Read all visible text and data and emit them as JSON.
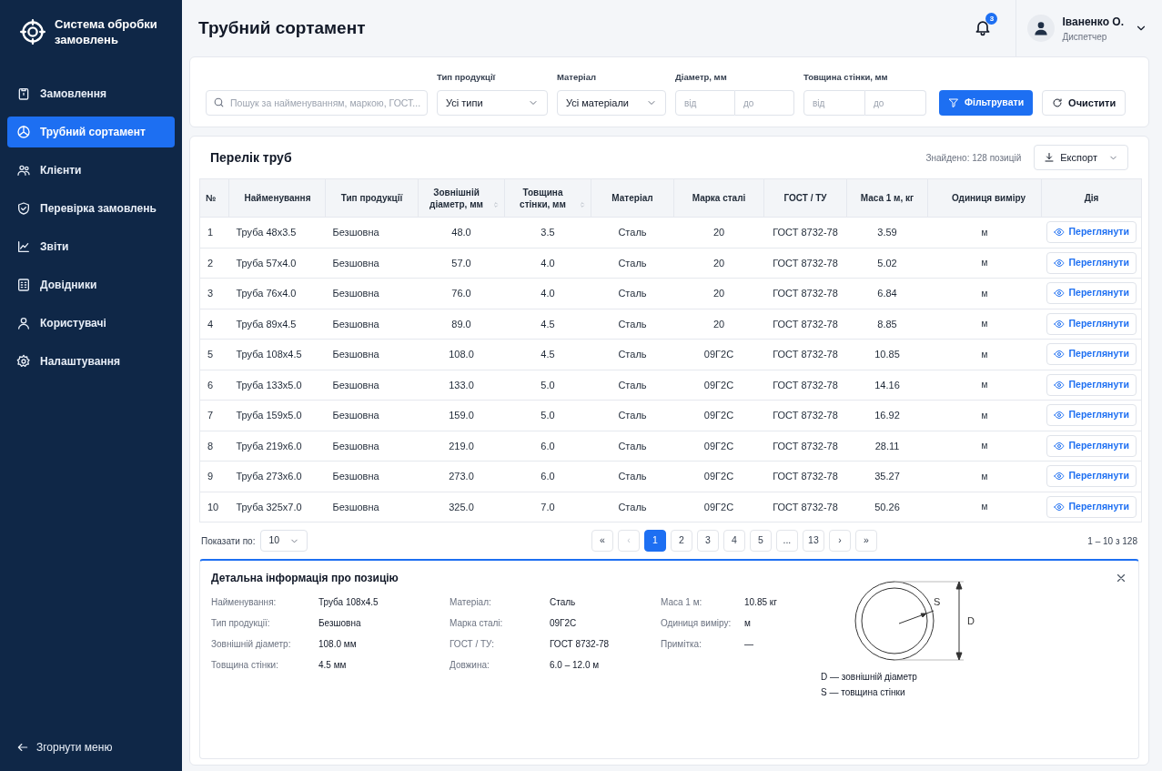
{
  "app": {
    "title": "Система обробки замовлень"
  },
  "sidebar": {
    "items": [
      {
        "label": "Замовлення",
        "selected": false
      },
      {
        "label": "Трубний сортамент",
        "selected": true
      },
      {
        "label": "Клієнти",
        "selected": false
      },
      {
        "label": "Перевірка замовлень",
        "selected": false
      },
      {
        "label": "Звіти",
        "selected": false
      },
      {
        "label": "Довідники",
        "selected": false
      },
      {
        "label": "Користувачі",
        "selected": false
      },
      {
        "label": "Налаштування",
        "selected": false
      }
    ],
    "collapse": "Згорнути меню"
  },
  "header": {
    "title": "Трубний сортамент",
    "notifications": "3",
    "user": {
      "name": "Іваненко О.",
      "role": "Диспетчер"
    }
  },
  "filters": {
    "search": {
      "placeholder": "Пошук за найменуванням, маркою, ГОСТ..."
    },
    "type": {
      "label": "Тип продукції",
      "value": "Усі типи"
    },
    "material": {
      "label": "Матеріал",
      "value": "Усі матеріали"
    },
    "diameter": {
      "label": "Діаметр, мм",
      "from": "від",
      "to": "до"
    },
    "wall": {
      "label": "Товщина стінки, мм",
      "from": "від",
      "to": "до"
    },
    "apply": "Фільтрувати",
    "clear": "Очистити"
  },
  "table": {
    "title": "Перелік труб",
    "found": "Знайдено: 128 позицій",
    "export": "Експорт",
    "columns": [
      {
        "label": "№",
        "sortable": false
      },
      {
        "label": "Найменування",
        "sortable": false
      },
      {
        "label": "Тип продукції",
        "sortable": false
      },
      {
        "label": "Зовнішній діаметр, мм",
        "sortable": true
      },
      {
        "label": "Товщина стінки, мм",
        "sortable": true
      },
      {
        "label": "Матеріал",
        "sortable": false
      },
      {
        "label": "Марка сталі",
        "sortable": false
      },
      {
        "label": "ГОСТ / ТУ",
        "sortable": false
      },
      {
        "label": "Маса 1 м, кг",
        "sortable": false
      },
      {
        "label": "Одиниця виміру",
        "sortable": false
      },
      {
        "label": "Дія",
        "sortable": false
      }
    ],
    "rows": [
      {
        "cells": [
          "1",
          "Труба 48x3.5",
          "Безшовна",
          "48.0",
          "3.5",
          "Сталь",
          "20",
          "ГОСТ 8732-78",
          "3.59",
          "м"
        ],
        "action": "Переглянути"
      },
      {
        "cells": [
          "2",
          "Труба 57x4.0",
          "Безшовна",
          "57.0",
          "4.0",
          "Сталь",
          "20",
          "ГОСТ 8732-78",
          "5.02",
          "м"
        ],
        "action": "Переглянути"
      },
      {
        "cells": [
          "3",
          "Труба 76x4.0",
          "Безшовна",
          "76.0",
          "4.0",
          "Сталь",
          "20",
          "ГОСТ 8732-78",
          "6.84",
          "м"
        ],
        "action": "Переглянути"
      },
      {
        "cells": [
          "4",
          "Труба 89x4.5",
          "Безшовна",
          "89.0",
          "4.5",
          "Сталь",
          "20",
          "ГОСТ 8732-78",
          "8.85",
          "м"
        ],
        "action": "Переглянути"
      },
      {
        "cells": [
          "5",
          "Труба 108x4.5",
          "Безшовна",
          "108.0",
          "4.5",
          "Сталь",
          "09Г2С",
          "ГОСТ 8732-78",
          "10.85",
          "м"
        ],
        "action": "Переглянути"
      },
      {
        "cells": [
          "6",
          "Труба 133x5.0",
          "Безшовна",
          "133.0",
          "5.0",
          "Сталь",
          "09Г2С",
          "ГОСТ 8732-78",
          "14.16",
          "м"
        ],
        "action": "Переглянути"
      },
      {
        "cells": [
          "7",
          "Труба 159x5.0",
          "Безшовна",
          "159.0",
          "5.0",
          "Сталь",
          "09Г2С",
          "ГОСТ 8732-78",
          "16.92",
          "м"
        ],
        "action": "Переглянути"
      },
      {
        "cells": [
          "8",
          "Труба 219x6.0",
          "Безшовна",
          "219.0",
          "6.0",
          "Сталь",
          "09Г2С",
          "ГОСТ 8732-78",
          "28.11",
          "м"
        ],
        "action": "Переглянути"
      },
      {
        "cells": [
          "9",
          "Труба 273x6.0",
          "Безшовна",
          "273.0",
          "6.0",
          "Сталь",
          "09Г2С",
          "ГОСТ 8732-78",
          "35.27",
          "м"
        ],
        "action": "Переглянути"
      },
      {
        "cells": [
          "10",
          "Труба 325x7.0",
          "Безшовна",
          "325.0",
          "7.0",
          "Сталь",
          "09Г2С",
          "ГОСТ 8732-78",
          "50.26",
          "м"
        ],
        "action": "Переглянути"
      }
    ]
  },
  "pagination": {
    "page_size_label": "Показати по:",
    "page_size": "10",
    "range": "1 – 10 з 128",
    "pages": [
      {
        "label": "«",
        "selected": false,
        "disabled": false
      },
      {
        "label": "‹",
        "selected": false,
        "disabled": true
      },
      {
        "label": "1",
        "selected": true,
        "disabled": false
      },
      {
        "label": "2",
        "selected": false,
        "disabled": false
      },
      {
        "label": "3",
        "selected": false,
        "disabled": false
      },
      {
        "label": "4",
        "selected": false,
        "disabled": false
      },
      {
        "label": "5",
        "selected": false,
        "disabled": false
      },
      {
        "label": "...",
        "selected": false,
        "disabled": false
      },
      {
        "label": "13",
        "selected": false,
        "disabled": false
      },
      {
        "label": "›",
        "selected": false,
        "disabled": false
      },
      {
        "label": "»",
        "selected": false,
        "disabled": false
      }
    ]
  },
  "details": {
    "title": "Детальна інформація про позицію",
    "columns": [
      [
        {
          "label": "Найменування:",
          "value": "Труба 108x4.5"
        },
        {
          "label": "Тип продукції:",
          "value": "Безшовна"
        },
        {
          "label": "Зовнішній діаметр:",
          "value": "108.0 мм"
        },
        {
          "label": "Товщина стінки:",
          "value": "4.5 мм"
        }
      ],
      [
        {
          "label": "Матеріал:",
          "value": "Сталь"
        },
        {
          "label": "Марка сталі:",
          "value": "09Г2С"
        },
        {
          "label": "ГОСТ / ТУ:",
          "value": "ГОСТ 8732-78"
        },
        {
          "label": "Довжина:",
          "value": "6.0 – 12.0 м"
        }
      ],
      [
        {
          "label": "Маса 1 м:",
          "value": "10.85 кг"
        },
        {
          "label": "Одиниця виміру:",
          "value": "м"
        },
        {
          "label": "Примітка:",
          "value": "—"
        }
      ]
    ],
    "diagram": {
      "s_label": "S",
      "d_label": "D",
      "legend": [
        "D — зовнішній діаметр",
        "S — товщина стінки"
      ]
    }
  }
}
